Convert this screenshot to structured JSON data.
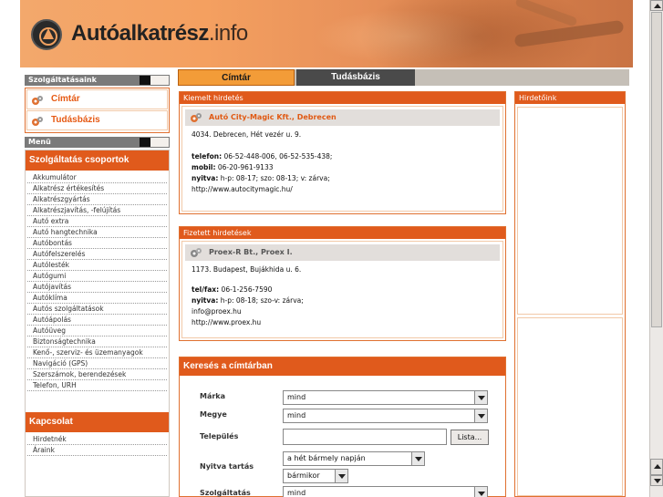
{
  "site": {
    "logo_main": "Autóalkatrész",
    "logo_tld": ".info"
  },
  "topnav": {
    "tabs": [
      {
        "label": "Címtár"
      },
      {
        "label": "Tudásbázis"
      }
    ]
  },
  "sidebar": {
    "services_title": "Szolgáltatásaink",
    "services": [
      {
        "label": "Címtár",
        "icon": "gear-icon"
      },
      {
        "label": "Tudásbázis",
        "icon": "gear-icon"
      }
    ],
    "menu_title": "Menü",
    "group_heading": "Szolgáltatás csoportok",
    "groups": [
      "Akkumulátor",
      "Alkatrész értékesítés",
      "Alkatrészgyártás",
      "Alkatrészjavítás, -felújítás",
      "Autó extra",
      "Autó hangtechnika",
      "Autóbontás",
      "Autófelszerelés",
      "Autólesték",
      "Autógumi",
      "Autójavítás",
      "Autóklíma",
      "Autós szolgáltatások",
      "Autóápolás",
      "Autóüveg",
      "Biztonságtechnika",
      "Kenő-, szerviz- és üzemanyagok",
      "Navigáció (GPS)",
      "Szerszámok, berendezések",
      "Telefon, URH"
    ],
    "contact_heading": "Kapcsolat",
    "contact_items": [
      "Hirdetnék",
      "Áraink"
    ]
  },
  "featured_ad": {
    "heading": "Kiemelt hirdetés",
    "company": "Autó City-Magic Kft., Debrecen",
    "address": "4034. Debrecen, Hét vezér u. 9.",
    "phone_label": "telefon:",
    "phone": "06-52-448-006, 06-52-535-438;",
    "mobile_label": "mobil:",
    "mobile": "06-20-961-9133",
    "hours_label": "nyitva:",
    "hours": "h-p: 08-17; szo: 08-13; v: zárva;",
    "website": "http://www.autocitymagic.hu/"
  },
  "paid_ad": {
    "heading": "Fizetett hirdetések",
    "company": "Proex-R Bt., Proex I.",
    "address": "1173. Budapest, Bujákhida u. 6.",
    "phone_label": "tel/fax:",
    "phone": "06-1-256-7590",
    "hours_label": "nyitva:",
    "hours": "h-p: 08-18; szo-v: zárva;",
    "email": "info@proex.hu",
    "website": "http://www.proex.hu"
  },
  "search": {
    "heading": "Keresés a címtárban",
    "brand_label": "Márka",
    "brand_value": "mind",
    "county_label": "Megye",
    "county_value": "mind",
    "city_label": "Település",
    "city_value": "",
    "list_button": "Lista...",
    "open_label": "Nyitva tartás",
    "open_value": "a hét bármely napján",
    "open_time_value": "bármikor",
    "service_label": "Szolgáltatás",
    "service_value": "mind"
  },
  "right": {
    "heading": "Hirdetőink"
  }
}
